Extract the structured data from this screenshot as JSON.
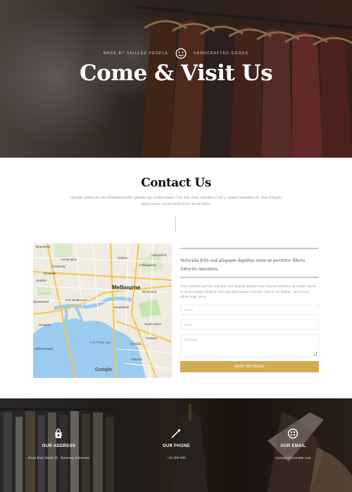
{
  "hero": {
    "tagline_left": "MADE BY SKILLED PEOPLE",
    "tagline_right": "HANDCRAFTED GOODS",
    "icon": "smile-icon",
    "title": "Come & Visit Us"
  },
  "contact": {
    "title": "Contact Us",
    "subtitle": "Quisque semper dui non bibendum iaculis. Quisque quis finibus neque. Cras nunc diam, pharetra et nisl a, semper bibendum elit. Nunc fringilla massa luctus, rutrum lorem tortor, luctus libero."
  },
  "map": {
    "city": "Melbourne",
    "labels": [
      "Melbourne",
      "Footscray",
      "Yarraville",
      "Port Melbourne",
      "Williamstown",
      "Newport",
      "Spotswood",
      "South Yarra",
      "Richmond",
      "Prahran",
      "Elwood",
      "St Kilda",
      "Collingwood",
      "Carlton",
      "Abbotsford",
      "Southbank",
      "Seddon",
      "Port Phillip Bay",
      "Brunswick",
      "Kensington"
    ],
    "attribution": "Google"
  },
  "form": {
    "quote": "Vehicula felis sed aliquam dapibus enim at porttitor libero lobortis maximus.",
    "paragraph": "Nunc molestie gravida vulputate. Sed aliquam dapibus enim lobortis maximus. In semper ipsum ac auctor aliquet. Nulla ut velit eget enim tempus molestie. Cras in nisi finibus, varius ex et, ullamcorper lacus.",
    "name_placeholder": "Name",
    "email_placeholder": "Email",
    "message_placeholder": "Message",
    "send_label": "SEND MESSAGE",
    "button_color": "#d4aa55"
  },
  "info": [
    {
      "icon": "shop-icon",
      "label": "OUR ADDRESS",
      "value": "Road Batu Street 35 - Bandung Indonesia"
    },
    {
      "icon": "needle-icon",
      "label": "OUR PHONE",
      "value": "+62 000 000"
    },
    {
      "icon": "button-icon",
      "label": "OUR EMAIL",
      "value": "example@example.com"
    }
  ]
}
